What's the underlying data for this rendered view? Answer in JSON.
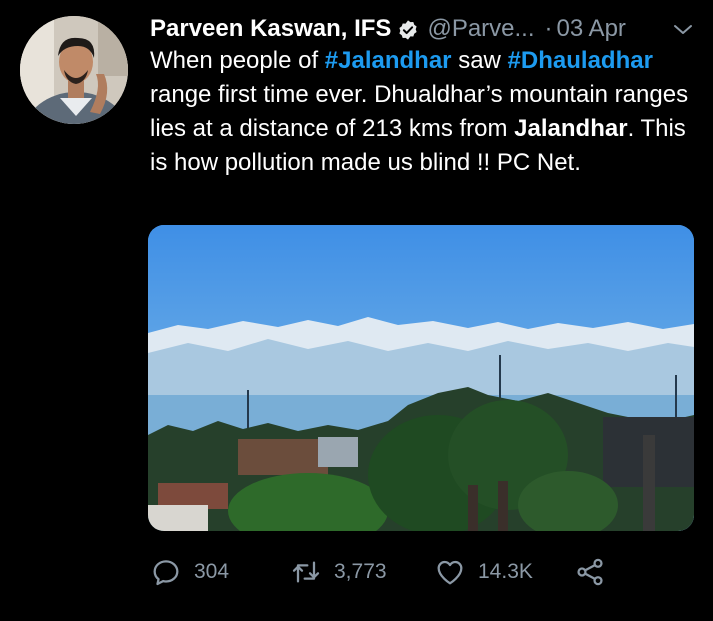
{
  "author": {
    "display_name": "Parveen Kaswan, IFS",
    "handle": "@Parve...",
    "separator": "·",
    "date": "03 Apr",
    "verified": true
  },
  "tweet": {
    "segments": [
      {
        "text": "When people of ",
        "style": "normal"
      },
      {
        "text": "#Jalandhar",
        "style": "hashtag"
      },
      {
        "text": " saw ",
        "style": "normal"
      },
      {
        "text": "#Dhauladhar",
        "style": "hashtag"
      },
      {
        "text": " range first time ever. Dhualdhar’s mountain ranges lies at a distance of 213 kms from ",
        "style": "normal"
      },
      {
        "text": "Jalandhar",
        "style": "bold"
      },
      {
        "text": ". This is how pollution made us blind !! PC Net.",
        "style": "normal"
      }
    ]
  },
  "actions": {
    "reply_count": "304",
    "retweet_count": "3,773",
    "like_count": "14.3K"
  },
  "icons": {
    "verified": "verified-badge-icon",
    "caret": "chevron-down-icon",
    "reply": "reply-icon",
    "retweet": "retweet-icon",
    "like": "heart-icon",
    "share": "share-icon"
  },
  "colors": {
    "background": "#000000",
    "text": "#ffffff",
    "secondary": "#8b98a5",
    "accent": "#1d9bf0"
  }
}
